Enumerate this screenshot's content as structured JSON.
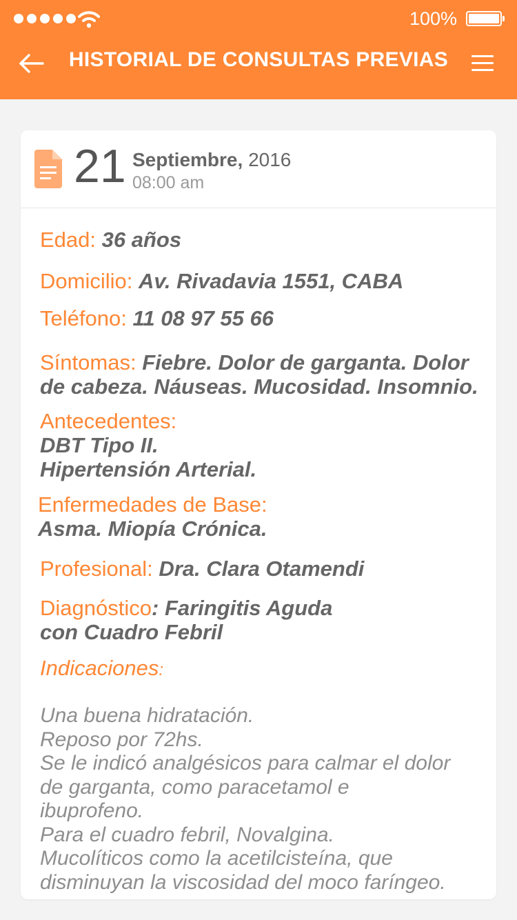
{
  "status": {
    "battery_percent": "100%",
    "signal_bars": 5
  },
  "header": {
    "title": "HISTORIAL DE CONSULTAS PREVIAS",
    "back_icon": "arrow-left-icon",
    "menu_icon": "hamburger-menu-icon",
    "color": "#ff8735"
  },
  "record": {
    "icon": "document-icon",
    "day": "21",
    "month": "Septiembre,",
    "year": "2016",
    "time": "08:00 am",
    "edad": {
      "label": "Edad:",
      "value": "36 años"
    },
    "domicilio": {
      "label": "Domicilio:",
      "value": "Av. Rivadavia 1551, CABA"
    },
    "telefono": {
      "label": "Teléfono:",
      "value": "11 08 97 55 66"
    },
    "sintomas": {
      "label": "Síntomas:",
      "value": "Fiebre. Dolor de garganta. Dolor de cabeza. Náuseas. Mucosidad. Insomnio."
    },
    "antecedentes": {
      "label": "Antecedentes:",
      "lines": [
        "DBT Tipo II.",
        "Hipertensión Arterial."
      ]
    },
    "enfermedades": {
      "label": "Enfermedades de Base:",
      "value": "Asma. Miopía Crónica."
    },
    "profesional": {
      "label": "Profesional:",
      "value": "Dra. Clara Otamendi"
    },
    "diagnostico": {
      "label": "Diagnóstico",
      "colon": ":",
      "value": "Faringitis Aguda",
      "value2": "con Cuadro Febril"
    },
    "indicaciones": {
      "label": "Indicaciones",
      "colon": ":",
      "lines": [
        "Una buena hidratación.",
        "Reposo por 72hs.",
        "Se le indicó analgésicos para calmar el dolor",
        "de garganta, como paracetamol e",
        "ibuprofeno.",
        "Para el cuadro febril, Novalgina.",
        "Mucolíticos como la acetilcisteína, que",
        "disminuyan la viscosidad del moco faríngeo."
      ]
    }
  }
}
